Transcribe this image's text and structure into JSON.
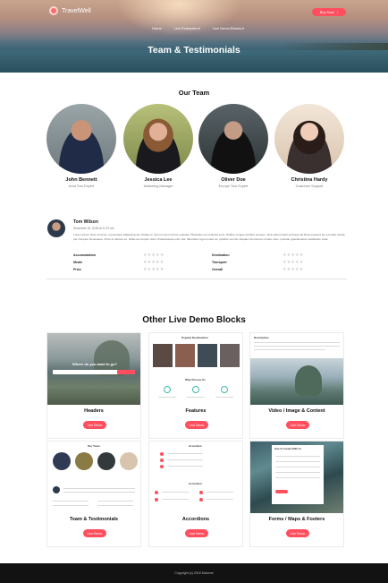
{
  "header": {
    "logo_text": "TravelWell",
    "buy_label": "Buy Now",
    "buy_arrow": "›",
    "nav": [
      "Home",
      "Live Examples ▾",
      "Live Demo Blocks ▾"
    ],
    "page_title": "Team & Testimonials"
  },
  "team": {
    "title": "Our Team",
    "members": [
      {
        "name": "John Bennett",
        "role": "Area Tour Expert"
      },
      {
        "name": "Jessica Lee",
        "role": "Marketing Manager"
      },
      {
        "name": "Oliver Doe",
        "role": "Europe Tour Expert"
      },
      {
        "name": "Christina Hardy",
        "role": "Customer Support"
      }
    ]
  },
  "review": {
    "name": "Tom Wilson",
    "date": "December 15, 2018 at 11:37 am",
    "text": "Lorem ipsum dolor sit amet, consectetur adipiscing elit. Nullam in nisi non arcu rutrum molestie. Phasellus vel vehicula enim. Nullam congue porttitor posuere. Duis aptent taciti sociosqu ad litora torquent per conubia nostra, per inceptos himenaeos. Proin et ultrices ex. Nulla nec tempor dolor. Pellentesque enim nisl, bibendum eget ornare ac, porttitor vel nisl. Aliquam fermentum ornare nunc, pulvinar gravida lacus vestibulum vitae.",
    "ratings": [
      {
        "label": "Accomodation",
        "stars": "★★★★★"
      },
      {
        "label": "Meals",
        "stars": "★★★★★"
      },
      {
        "label": "Price",
        "stars": "★★★★★"
      },
      {
        "label": "Destination",
        "stars": "★★★★★"
      },
      {
        "label": "Transport",
        "stars": "★★★★★"
      },
      {
        "label": "Overall",
        "stars": "★★★★★"
      }
    ]
  },
  "other": {
    "title": "Other Live Demo Blocks",
    "cards": [
      {
        "title": "Headers",
        "button": "Live Demo"
      },
      {
        "title": "Features",
        "button": "Live Demo"
      },
      {
        "title": "Video / Image & Content",
        "button": "Live Demo"
      },
      {
        "title": "Team & Testimonials",
        "button": "Live Demo"
      },
      {
        "title": "Accordions",
        "button": "Live Demo"
      },
      {
        "title": "Forms / Maps & Footers",
        "button": "Live Demo"
      }
    ],
    "thumb_texts": {
      "headers_caption": "Where do you want to go?",
      "features_heading": "Popular Destinations",
      "features_sub": "Why Choose Us",
      "video_heading": "Description",
      "team_heading": "Our Team",
      "acc_heading_1": "Accordion",
      "acc_heading_2": "Accordion",
      "form_heading": "How To Contact With Us"
    }
  },
  "footer": {
    "text": "Copyright (c) 2018 Malorne"
  }
}
